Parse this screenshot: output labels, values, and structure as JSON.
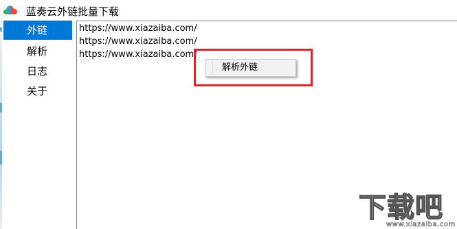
{
  "window": {
    "title": "蓝奏云外链批量下载"
  },
  "sidebar": {
    "items": [
      {
        "label": "外链",
        "selected": true
      },
      {
        "label": "解析",
        "selected": false
      },
      {
        "label": "日志",
        "selected": false
      },
      {
        "label": "关于",
        "selected": false
      }
    ]
  },
  "content": {
    "links": [
      "https://www.xiazaiba.com/",
      "https://www.xiazaiba.com/",
      "https://www.xiazaiba.com/"
    ]
  },
  "context_menu": {
    "items": [
      {
        "label": "解析外链"
      }
    ]
  },
  "watermark": {
    "logo_text": "下载吧",
    "url_text": "www.xiazaiba.com"
  },
  "colors": {
    "selected_background": "#0078d7",
    "highlight_border": "#d9262b"
  }
}
